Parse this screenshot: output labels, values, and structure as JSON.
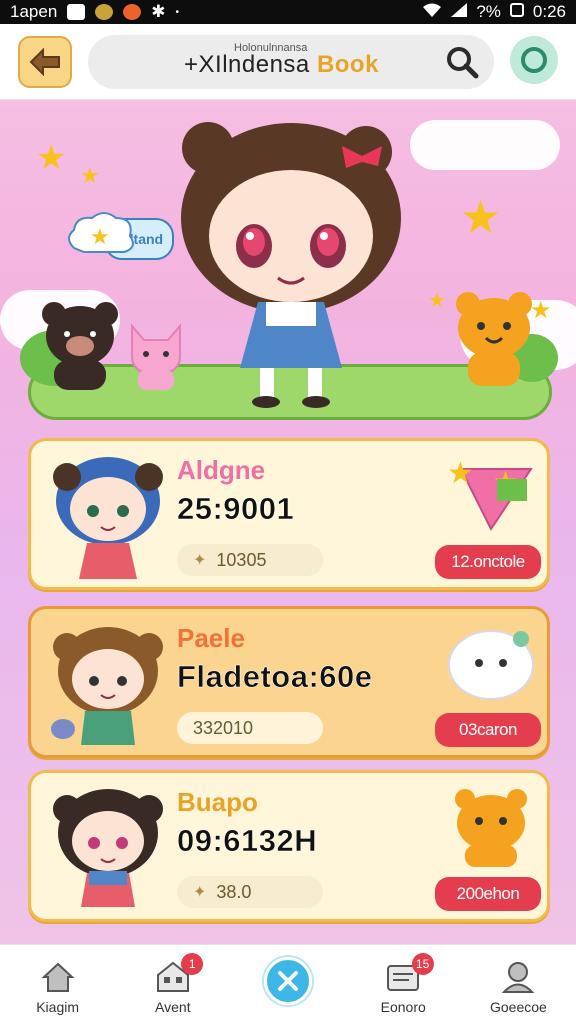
{
  "status_bar": {
    "carrier": "1apen",
    "battery": "?%",
    "time": "0:26"
  },
  "header": {
    "search_subtitle": "Holonulnnansa",
    "search_title_main": "+XIlndensa ",
    "search_title_accent": "Book"
  },
  "hero": {
    "speech_text": "Bdtand"
  },
  "cards": [
    {
      "name": "Aldgne",
      "value": "25:9001",
      "stat": "10305",
      "button": "12.onctole",
      "name_color": "#f06fa6"
    },
    {
      "name": "Paele",
      "value": "Fladetoa:60e",
      "stat": "332010",
      "button": "03caron",
      "name_color": "#f0733a"
    },
    {
      "name": "Buapo",
      "value": "09:6132H",
      "stat": "38.0",
      "button": "200ehon",
      "name_color": "#e8a32a"
    }
  ],
  "nav": [
    {
      "label": "Kiagim",
      "icon": "home-icon"
    },
    {
      "label": "Avent",
      "icon": "store-icon",
      "badge": "1"
    },
    {
      "label": "",
      "icon": "close-icon"
    },
    {
      "label": "Eonoro",
      "icon": "inbox-icon",
      "badge": "15"
    },
    {
      "label": "Goeecoe",
      "icon": "profile-icon"
    }
  ],
  "colors": {
    "accent": "#e43e4e",
    "brand": "#f3b94a",
    "teal": "#2e8a6c"
  }
}
